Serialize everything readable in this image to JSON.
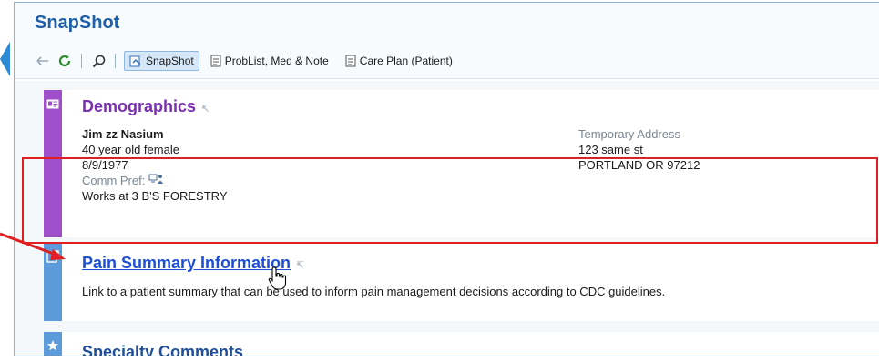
{
  "app": {
    "title": "SnapShot"
  },
  "toolbar": {
    "tabs": [
      {
        "label": "SnapShot",
        "icon": "snapshot-icon",
        "active": true
      },
      {
        "label": "ProbList, Med & Note",
        "icon": "document-icon",
        "active": false
      },
      {
        "label": "Care Plan (Patient)",
        "icon": "document-icon",
        "active": false
      }
    ]
  },
  "demographics": {
    "title": "Demographics",
    "patient_name": "Jim zz Nasium",
    "age_sex": "40 year old female",
    "dob": "8/9/1977",
    "comm_pref_label": "Comm Pref:",
    "employer": "Works at 3 B'S FORESTRY",
    "address_label": "Temporary Address",
    "address_line1": "123 same st",
    "address_line2": "PORTLAND OR 97212"
  },
  "pain_summary": {
    "title": "Pain Summary Information",
    "description": "Link to a patient summary that can be used to inform pain management decisions according to CDC guidelines."
  },
  "specialty_comments": {
    "title": "Specialty Comments"
  },
  "colors": {
    "accent": "#1f5fa8",
    "demographics_bar": "#9e4fc9",
    "pain_bar": "#5b9bd9",
    "highlight": "#e02020",
    "link": "#1d4fd6"
  }
}
